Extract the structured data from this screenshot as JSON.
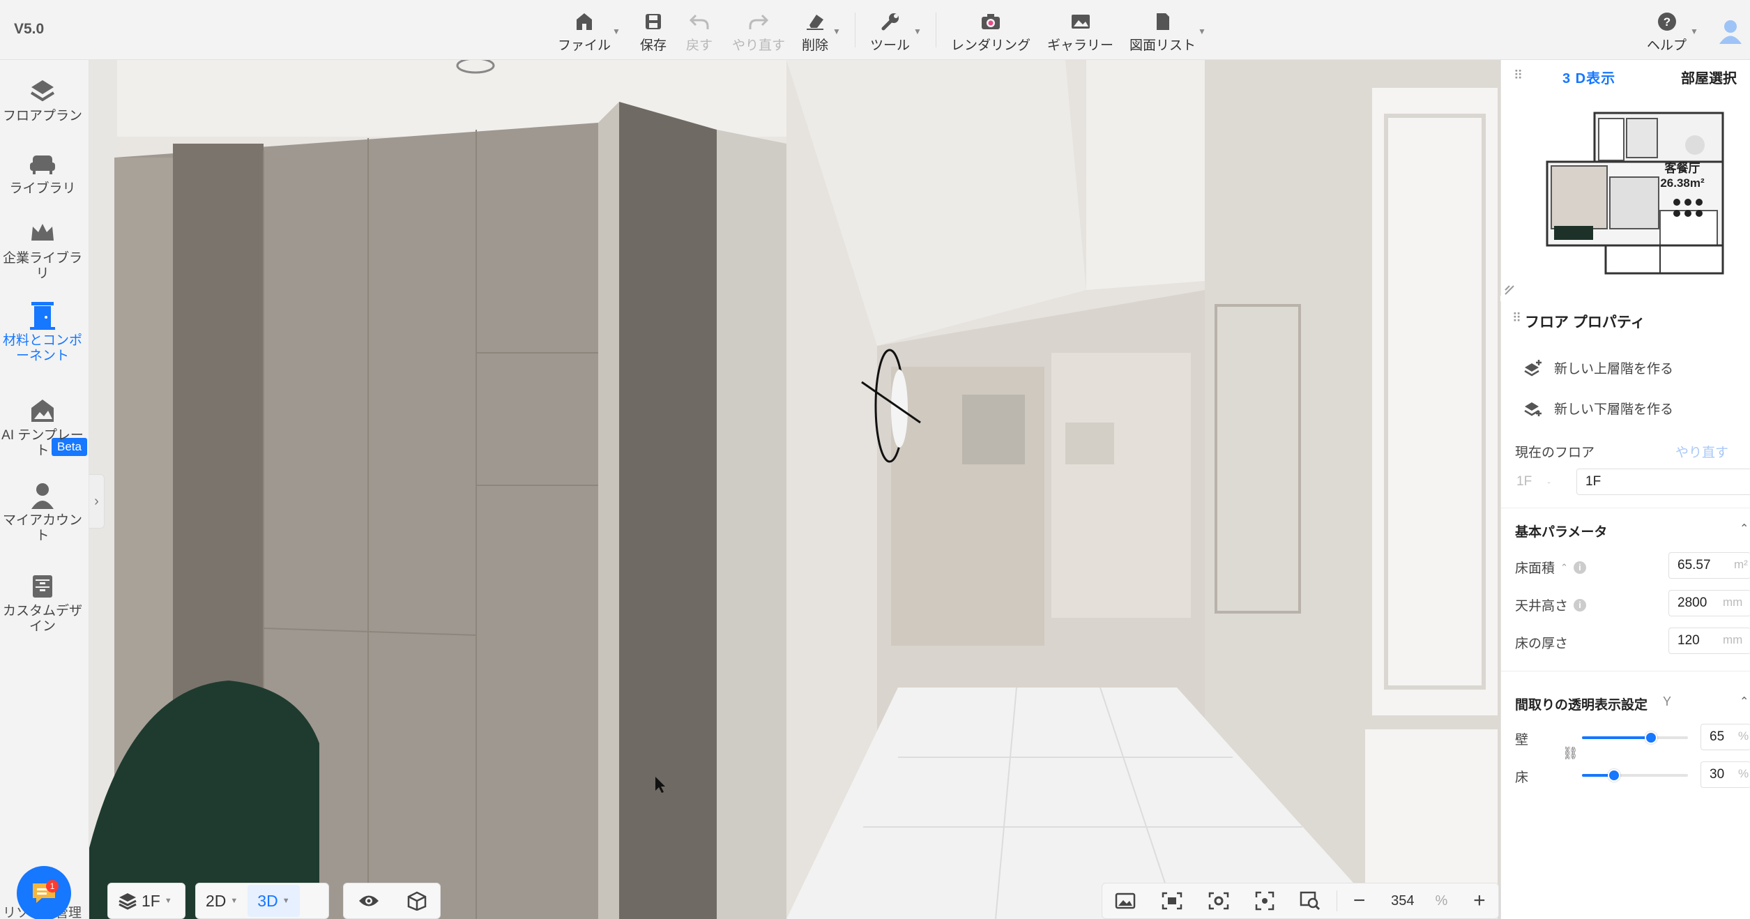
{
  "app": {
    "version": "V5.0"
  },
  "toolbar": {
    "file": "ファイル",
    "save": "保存",
    "undo": "戻す",
    "redo": "やり直す",
    "delete": "削除",
    "tools": "ツール",
    "rendering": "レンダリング",
    "gallery": "ギャラリー",
    "drawing_list": "図面リスト",
    "help": "ヘルプ"
  },
  "sidebar": {
    "items": [
      {
        "label": "フロアプラン"
      },
      {
        "label": "ライブラリ"
      },
      {
        "label": "企業ライブラリ"
      },
      {
        "label": "材料とコンポーネント"
      },
      {
        "label": "AI テンプレート"
      },
      {
        "label": "マイアカウント"
      },
      {
        "label": "カスタムデザイン"
      }
    ],
    "beta": "Beta",
    "bottom_label": "リソース管理"
  },
  "bottom": {
    "floor": "1F",
    "view_2d": "2D",
    "view_3d": "3D",
    "zoom_value": "354",
    "zoom_unit": "%"
  },
  "minimap": {
    "tab_3d": "3 D表示",
    "tab_room": "部屋選択",
    "room_name": "客餐厅",
    "room_area": "26.38m²"
  },
  "props": {
    "title": "フロア プロパティ",
    "new_upper": "新しい上層階を作る",
    "new_lower": "新しい下層階を作る",
    "current_floor_label": "現在のフロア",
    "redo_link": "やり直す",
    "floor_prefix": "1F",
    "floor_name": "1F",
    "basic_title": "基本パラメータ",
    "floor_area_label": "床面積",
    "floor_area_value": "65.57",
    "floor_area_unit": "m²",
    "ceiling_label": "天井高さ",
    "ceiling_value": "2800",
    "ceiling_unit": "mm",
    "thickness_label": "床の厚さ",
    "thickness_value": "120",
    "thickness_unit": "mm",
    "transparency_title": "間取りの透明表示設定",
    "transparency_suffix": "Y",
    "wall_label": "壁",
    "wall_value": "65",
    "floor_label": "床",
    "floor_value": "30",
    "percent": "%"
  },
  "colors": {
    "accent": "#1677ff"
  }
}
